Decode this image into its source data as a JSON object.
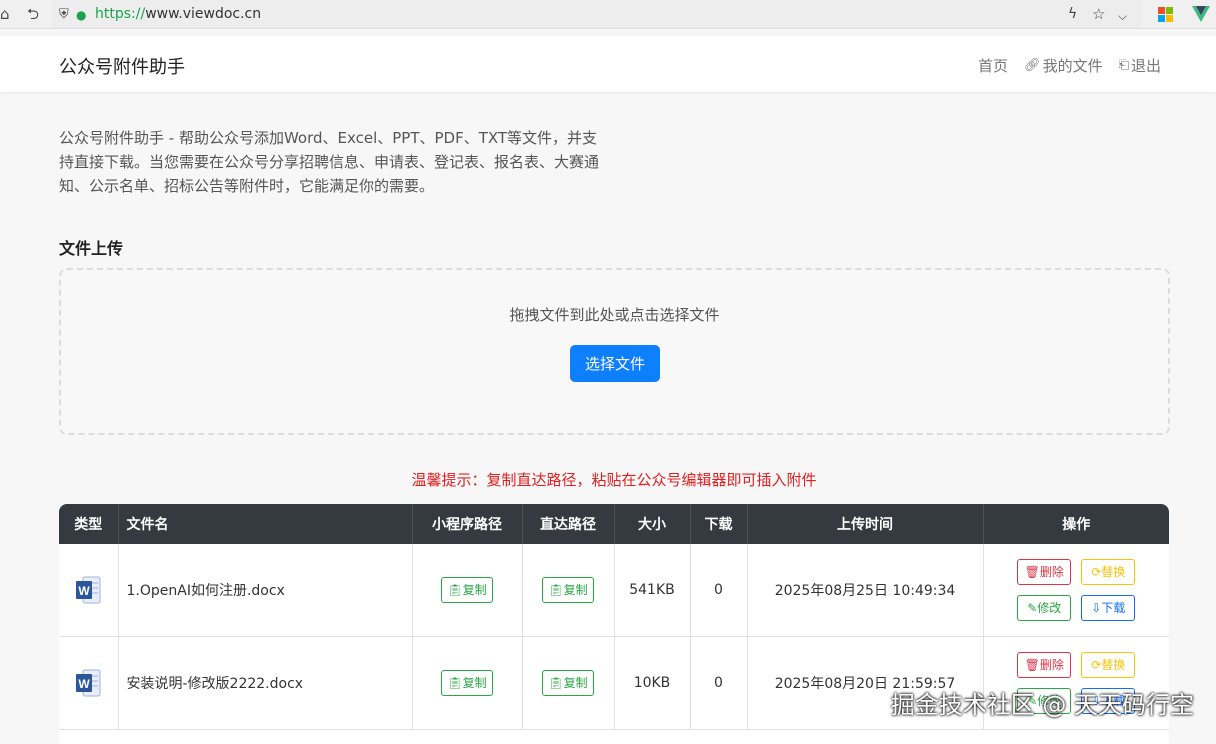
{
  "browser": {
    "url_scheme": "https://",
    "url_host": "www.viewdoc.cn"
  },
  "header": {
    "brand": "公众号附件助手",
    "nav": [
      {
        "label": "首页",
        "icon": ""
      },
      {
        "label": "我的文件",
        "icon": "link-icon"
      },
      {
        "label": "退出",
        "icon": "logout-icon"
      }
    ]
  },
  "intro": {
    "text": "公众号附件助手 - 帮助公众号添加Word、Excel、PPT、PDF、TXT等文件，并支持直接下载。当您需要在公众号分享招聘信息、申请表、登记表、报名表、大赛通知、公示名单、招标公告等附件时，它能满足你的需要。"
  },
  "upload": {
    "section_title": "文件上传",
    "drop_text": "拖拽文件到此处或点击选择文件",
    "button_label": "选择文件"
  },
  "tip": "温馨提示：复制直达路径，粘贴在公众号编辑器即可插入附件",
  "table": {
    "headers": [
      "类型",
      "文件名",
      "小程序路径",
      "直达路径",
      "大小",
      "下载",
      "上传时间",
      "操作"
    ],
    "copy_label": "复制",
    "actions": {
      "delete": "删除",
      "replace": "替换",
      "edit": "修改",
      "download": "下载"
    },
    "rows": [
      {
        "type": "word",
        "name": "1.OpenAI如何注册.docx",
        "size": "541KB",
        "downloads": "0",
        "time": "2025年08月25日 10:49:34"
      },
      {
        "type": "word",
        "name": "安装说明-修改版2222.docx",
        "size": "10KB",
        "downloads": "0",
        "time": "2025年08月20日 21:59:57"
      }
    ]
  },
  "watermark": "掘金技术社区 @ 天天码行空",
  "colors": {
    "primary": "#0d7fff",
    "header_dark": "#343a40",
    "tip_red": "#e02020",
    "success": "#28a745"
  }
}
